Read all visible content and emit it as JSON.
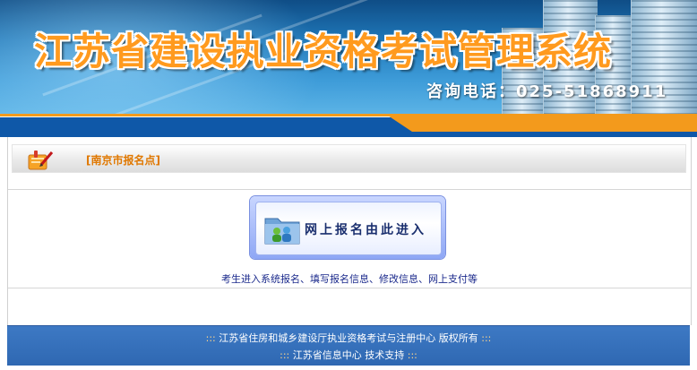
{
  "banner": {
    "title": "江苏省建设执业资格考试管理系统",
    "phone": "咨询电话：025-51868911"
  },
  "section": {
    "label": "[南京市报名点]"
  },
  "entry_button": {
    "label": "网上报名由此进入"
  },
  "note": "考生进入系统报名、填写报名信息、修改信息、网上支付等",
  "footer": {
    "line1_prefix": ":::",
    "line1_text": "江苏省住房和城乡建设厅执业资格考试与注册中心 版权所有",
    "line1_suffix": ":::",
    "line2_prefix": ":::",
    "line2_text": "江苏省信息中心 技术支持",
    "line2_suffix": ":::"
  },
  "colors": {
    "banner_blue": "#1f77b8",
    "title_orange": "#ff9a1e",
    "band_orange": "#f39a1c",
    "band_blue": "#0f58a8",
    "label_orange": "#e07800",
    "note_blue": "#1b2a8c",
    "footer_blue": "#3d79c4"
  },
  "icons": {
    "section": "memo-pencil-icon",
    "entry": "folder-users-icon"
  }
}
